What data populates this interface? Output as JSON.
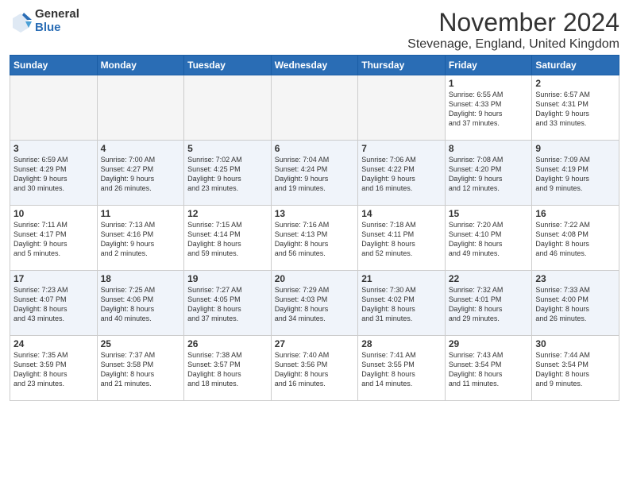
{
  "logo": {
    "general": "General",
    "blue": "Blue"
  },
  "title": "November 2024",
  "location": "Stevenage, England, United Kingdom",
  "days_header": [
    "Sunday",
    "Monday",
    "Tuesday",
    "Wednesday",
    "Thursday",
    "Friday",
    "Saturday"
  ],
  "weeks": [
    [
      {
        "day": "",
        "info": ""
      },
      {
        "day": "",
        "info": ""
      },
      {
        "day": "",
        "info": ""
      },
      {
        "day": "",
        "info": ""
      },
      {
        "day": "",
        "info": ""
      },
      {
        "day": "1",
        "info": "Sunrise: 6:55 AM\nSunset: 4:33 PM\nDaylight: 9 hours\nand 37 minutes."
      },
      {
        "day": "2",
        "info": "Sunrise: 6:57 AM\nSunset: 4:31 PM\nDaylight: 9 hours\nand 33 minutes."
      }
    ],
    [
      {
        "day": "3",
        "info": "Sunrise: 6:59 AM\nSunset: 4:29 PM\nDaylight: 9 hours\nand 30 minutes."
      },
      {
        "day": "4",
        "info": "Sunrise: 7:00 AM\nSunset: 4:27 PM\nDaylight: 9 hours\nand 26 minutes."
      },
      {
        "day": "5",
        "info": "Sunrise: 7:02 AM\nSunset: 4:25 PM\nDaylight: 9 hours\nand 23 minutes."
      },
      {
        "day": "6",
        "info": "Sunrise: 7:04 AM\nSunset: 4:24 PM\nDaylight: 9 hours\nand 19 minutes."
      },
      {
        "day": "7",
        "info": "Sunrise: 7:06 AM\nSunset: 4:22 PM\nDaylight: 9 hours\nand 16 minutes."
      },
      {
        "day": "8",
        "info": "Sunrise: 7:08 AM\nSunset: 4:20 PM\nDaylight: 9 hours\nand 12 minutes."
      },
      {
        "day": "9",
        "info": "Sunrise: 7:09 AM\nSunset: 4:19 PM\nDaylight: 9 hours\nand 9 minutes."
      }
    ],
    [
      {
        "day": "10",
        "info": "Sunrise: 7:11 AM\nSunset: 4:17 PM\nDaylight: 9 hours\nand 5 minutes."
      },
      {
        "day": "11",
        "info": "Sunrise: 7:13 AM\nSunset: 4:16 PM\nDaylight: 9 hours\nand 2 minutes."
      },
      {
        "day": "12",
        "info": "Sunrise: 7:15 AM\nSunset: 4:14 PM\nDaylight: 8 hours\nand 59 minutes."
      },
      {
        "day": "13",
        "info": "Sunrise: 7:16 AM\nSunset: 4:13 PM\nDaylight: 8 hours\nand 56 minutes."
      },
      {
        "day": "14",
        "info": "Sunrise: 7:18 AM\nSunset: 4:11 PM\nDaylight: 8 hours\nand 52 minutes."
      },
      {
        "day": "15",
        "info": "Sunrise: 7:20 AM\nSunset: 4:10 PM\nDaylight: 8 hours\nand 49 minutes."
      },
      {
        "day": "16",
        "info": "Sunrise: 7:22 AM\nSunset: 4:08 PM\nDaylight: 8 hours\nand 46 minutes."
      }
    ],
    [
      {
        "day": "17",
        "info": "Sunrise: 7:23 AM\nSunset: 4:07 PM\nDaylight: 8 hours\nand 43 minutes."
      },
      {
        "day": "18",
        "info": "Sunrise: 7:25 AM\nSunset: 4:06 PM\nDaylight: 8 hours\nand 40 minutes."
      },
      {
        "day": "19",
        "info": "Sunrise: 7:27 AM\nSunset: 4:05 PM\nDaylight: 8 hours\nand 37 minutes."
      },
      {
        "day": "20",
        "info": "Sunrise: 7:29 AM\nSunset: 4:03 PM\nDaylight: 8 hours\nand 34 minutes."
      },
      {
        "day": "21",
        "info": "Sunrise: 7:30 AM\nSunset: 4:02 PM\nDaylight: 8 hours\nand 31 minutes."
      },
      {
        "day": "22",
        "info": "Sunrise: 7:32 AM\nSunset: 4:01 PM\nDaylight: 8 hours\nand 29 minutes."
      },
      {
        "day": "23",
        "info": "Sunrise: 7:33 AM\nSunset: 4:00 PM\nDaylight: 8 hours\nand 26 minutes."
      }
    ],
    [
      {
        "day": "24",
        "info": "Sunrise: 7:35 AM\nSunset: 3:59 PM\nDaylight: 8 hours\nand 23 minutes."
      },
      {
        "day": "25",
        "info": "Sunrise: 7:37 AM\nSunset: 3:58 PM\nDaylight: 8 hours\nand 21 minutes."
      },
      {
        "day": "26",
        "info": "Sunrise: 7:38 AM\nSunset: 3:57 PM\nDaylight: 8 hours\nand 18 minutes."
      },
      {
        "day": "27",
        "info": "Sunrise: 7:40 AM\nSunset: 3:56 PM\nDaylight: 8 hours\nand 16 minutes."
      },
      {
        "day": "28",
        "info": "Sunrise: 7:41 AM\nSunset: 3:55 PM\nDaylight: 8 hours\nand 14 minutes."
      },
      {
        "day": "29",
        "info": "Sunrise: 7:43 AM\nSunset: 3:54 PM\nDaylight: 8 hours\nand 11 minutes."
      },
      {
        "day": "30",
        "info": "Sunrise: 7:44 AM\nSunset: 3:54 PM\nDaylight: 8 hours\nand 9 minutes."
      }
    ]
  ]
}
